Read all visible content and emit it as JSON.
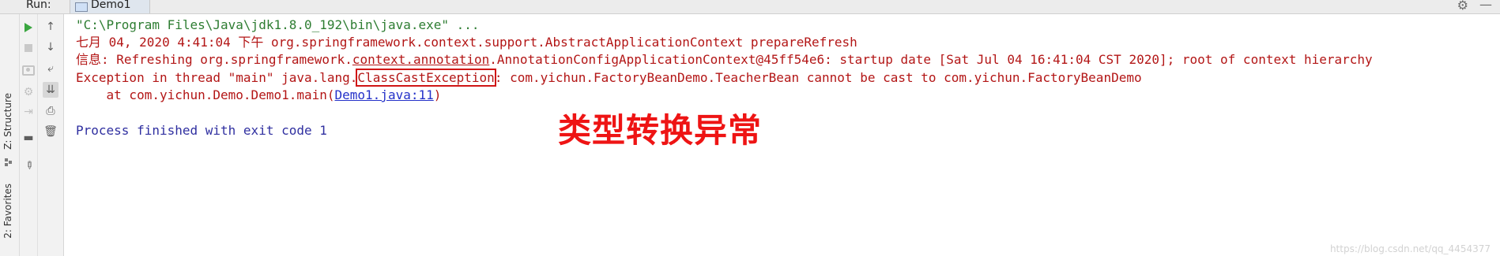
{
  "run_bar": {
    "label": "Run:",
    "tab_label": "Demo1"
  },
  "side_tabs": {
    "structure": "Z: Structure",
    "favorites": "2: Favorites"
  },
  "console": {
    "command_line": "\"C:\\Program Files\\Java\\jdk1.8.0_192\\bin\\java.exe\" ...",
    "log_line_1": "七月 04, 2020 4:41:04 下午 org.springframework.context.support.AbstractApplicationContext prepareRefresh",
    "log_line_2_prefix": "信息: Refreshing org.springframework.",
    "log_line_2_underlined": "context.annotation",
    "log_line_2_suffix": ".AnnotationConfigApplicationContext@45ff54e6: startup date [Sat Jul 04 16:41:04 CST 2020]; root of context hierarchy",
    "exception_prefix": "Exception in thread \"main\" java.lang.",
    "exception_class": "ClassCastException",
    "exception_suffix": ": com.yichun.FactoryBeanDemo.TeacherBean cannot be cast to com.yichun.FactoryBeanDemo",
    "stack_prefix": "    at com.yichun.Demo.Demo1.main(",
    "stack_link": "Demo1.java:11",
    "stack_suffix": ")",
    "exit_line": "Process finished with exit code 1"
  },
  "annotation_text": "类型转换异常",
  "watermark": "https://blog.csdn.net/qq_4454377",
  "colors": {
    "exit_green": "#2e7d32",
    "error_red": "#b31616",
    "process_blue": "#2f2fa0",
    "highlight_red": "#ee1414"
  }
}
